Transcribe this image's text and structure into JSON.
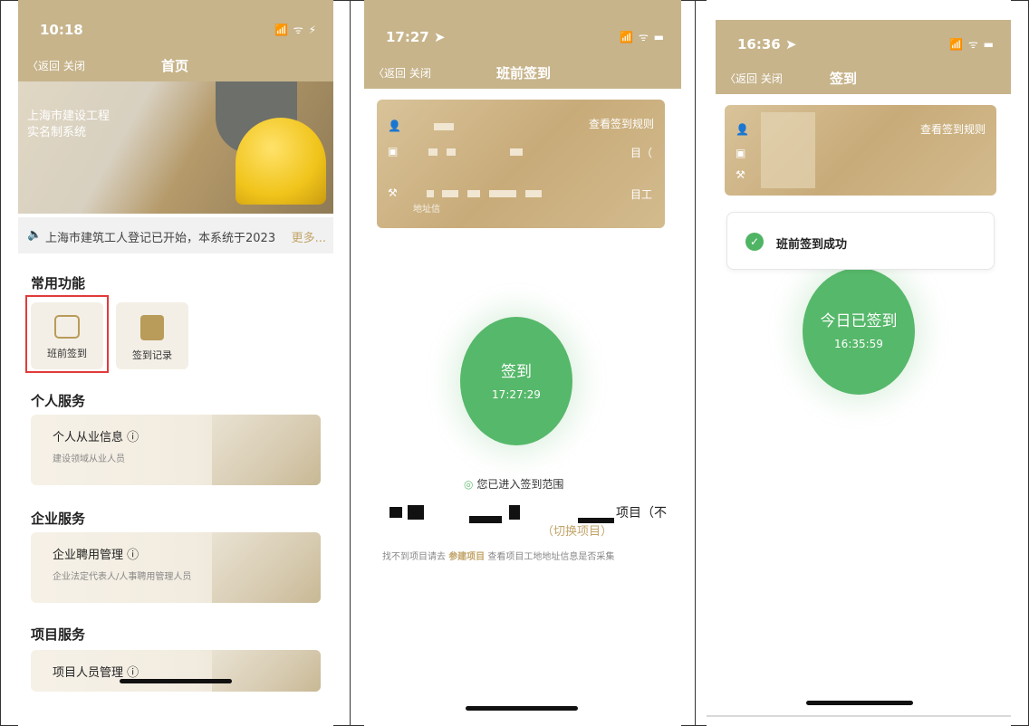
{
  "p1": {
    "time": "10:18",
    "signal": "📶 ᯤ ⚡",
    "back": "〈返回 关闭",
    "title": "首页",
    "banner": [
      "上海市建设工程",
      "实名制系统"
    ],
    "notice": "上海市建筑工人登记已开始，本系统于2023",
    "notice_more": "更多...",
    "sections": {
      "common": "常用功能",
      "personal": "个人服务",
      "enterprise": "企业服务",
      "project": "项目服务"
    },
    "tiles": [
      "班前签到",
      "签到记录"
    ],
    "cards": [
      {
        "title": "个人从业信息 ⓘ",
        "sub": "建设领域从业人员"
      },
      {
        "title": "企业聘用管理 ⓘ",
        "sub": "企业法定代表人/人事聘用管理人员"
      },
      {
        "title": "项目人员管理 ⓘ",
        "sub": ""
      }
    ]
  },
  "p2": {
    "time": "17:27 ➤",
    "signal": "📶 ᯤ ▬",
    "back": "〈返回 关闭",
    "title": "班前签到",
    "rule": "查看签到规则",
    "row2_tail": "目（",
    "row3_tail": "目工",
    "row3_sub": "地址信",
    "circle_label": "签到",
    "circle_time": "17:27:29",
    "range_text": "您已进入签到范围",
    "project_tail": "项目（不",
    "switch": "（切换项目）",
    "hint_pre": "找不到项目请去",
    "hint_link": "参建项目",
    "hint_post": "查看项目工地地址信息是否采集"
  },
  "p3": {
    "time": "16:36 ➤",
    "signal": "📶 ᯤ ▬",
    "back": "〈返回 关闭",
    "title": "签到",
    "rule": "查看签到规则",
    "toast": "班前签到成功",
    "circle_label": "今日已签到",
    "circle_time": "16:35:59"
  },
  "colors": {
    "gold": "#c7b48b",
    "green": "#56b86a",
    "accent": "#c2a56a",
    "red": "#e23a3a"
  }
}
